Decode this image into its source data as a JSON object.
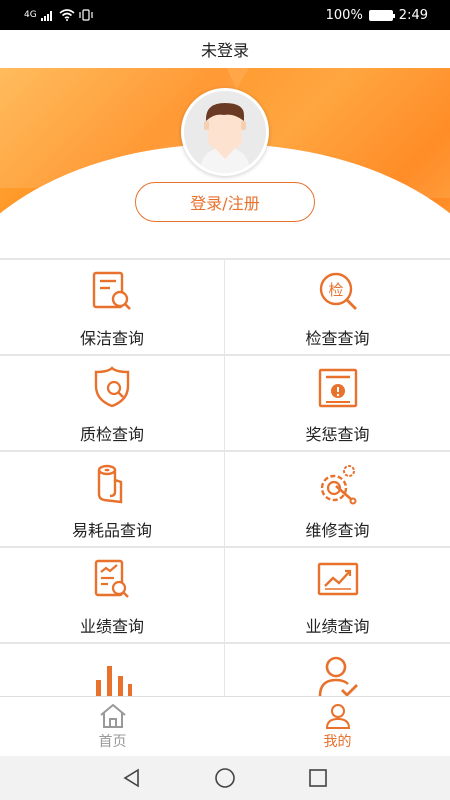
{
  "status_bar": {
    "network": "4G",
    "battery": "100%",
    "time": "2:49"
  },
  "header": {
    "title": "未登录"
  },
  "profile": {
    "login_label": "登录/注册"
  },
  "menu": {
    "items": [
      {
        "label": "保洁查询",
        "icon": "report-search-icon"
      },
      {
        "label": "检查查询",
        "icon": "inspect-search-icon"
      },
      {
        "label": "质检查询",
        "icon": "shield-search-icon"
      },
      {
        "label": "奖惩查询",
        "icon": "alert-document-icon"
      },
      {
        "label": "易耗品查询",
        "icon": "tissue-roll-icon"
      },
      {
        "label": "维修查询",
        "icon": "repair-gear-icon"
      },
      {
        "label": "业绩查询",
        "icon": "performance-doc-icon"
      },
      {
        "label": "业绩查询",
        "icon": "trend-chart-icon"
      },
      {
        "label": "",
        "icon": "bar-chart-icon"
      },
      {
        "label": "",
        "icon": "user-check-icon"
      }
    ]
  },
  "bottom_nav": {
    "home_label": "首页",
    "mine_label": "我的"
  },
  "colors": {
    "accent": "#e8712c"
  }
}
